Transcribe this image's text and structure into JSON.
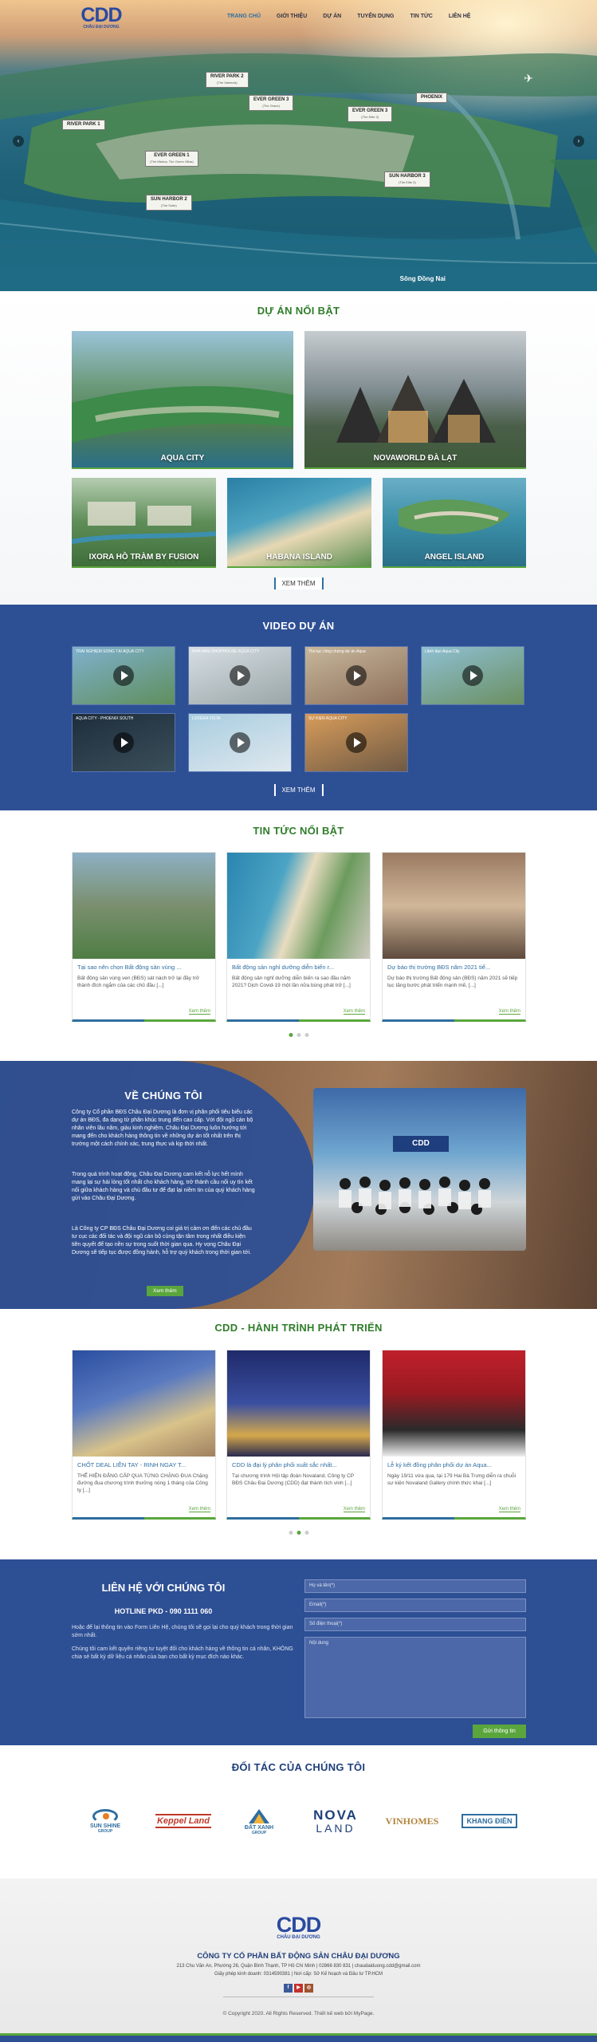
{
  "header": {
    "logo_text": "CDD",
    "logo_sub": "CHÂU ĐẠI DƯƠNG",
    "menu": [
      "TRANG CHỦ",
      "GIỚI THIỆU",
      "DỰ ÁN",
      "TUYỂN DỤNG",
      "TIN TỨC",
      "LIÊN HỆ"
    ],
    "active_color": "#2f6ea0"
  },
  "hero": {
    "labels": [
      {
        "name": "RIVER PARK 2",
        "sub": "(The Valencia)"
      },
      {
        "name": "RIVER PARK 1",
        "sub": ""
      },
      {
        "name": "EVER GREEN 3",
        "sub": "(The Grace)"
      },
      {
        "name": "EVER GREEN 3",
        "sub": "(The Elite 3)"
      },
      {
        "name": "PHOENIX",
        "sub": ""
      },
      {
        "name": "EVER GREEN 1",
        "sub": "(The Marina, The Green Villas)"
      },
      {
        "name": "SUN HARBOR 2",
        "sub": "(The Suite)"
      },
      {
        "name": "SUN HARBOR 3",
        "sub": "(The Elite 3)"
      }
    ],
    "river_label": "Sông Đồng Nai",
    "prev_icon": "chevron-left-icon",
    "next_icon": "chevron-right-icon"
  },
  "projects": {
    "title": "DỰ ÁN NỔI BẬT",
    "items": [
      "AQUA CITY",
      "NOVAWORLD ĐÀ LẠT",
      "IXORA HỒ TRÀM BY FUSION",
      "HABANA ISLAND",
      "ANGEL ISLAND"
    ],
    "more": "XEM THÊM"
  },
  "videos": {
    "title": "VIDEO DỰ ÁN",
    "items": [
      "TRẢI NGHIỆM SỐNG TẠI AQUA CITY",
      "NHÀ MẪU SHOPHOUSE AQUA CITY",
      "Thủ tục công chứng dự án Aqua",
      "Lãnh đạo Aqua City",
      "AQUA CITY - PHOENIX SOUTH",
      "LOVERA VISTA",
      "SỰ KIỆN AQUA CITY"
    ],
    "more": "XEM THÊM"
  },
  "news": {
    "title": "TIN TỨC NỔI BẬT",
    "items": [
      {
        "title": "Tại sao nên chọn Bất động sản vùng ...",
        "desc": "Bất động sản vùng ven (BĐS) sát nách trở lại đầy trở thành đích ngắm của các chủ đầu [...]",
        "more": "Xem thêm"
      },
      {
        "title": "Bất động sản nghỉ dưỡng diễn biến r...",
        "desc": "Bất động sản nghỉ dưỡng diễn biến ra sao đầu năm 2021? Dịch Covid-19 một lần nữa bùng phát trở [...]",
        "more": "Xem thêm"
      },
      {
        "title": "Dự báo thị trường BĐS năm 2021 tiế...",
        "desc": "Dự báo thị trường Bất động sản (BĐS) năm 2021 sẽ tiếp tục tăng bước phát triển mạnh mẽ, [...]",
        "more": "Xem thêm"
      }
    ]
  },
  "about": {
    "title": "VỀ CHÚNG TÔI",
    "p1": "Công ty Cổ phần BĐS Châu Đại Dương là đơn vị phân phối tiêu biểu các dự án BĐS, đa dạng từ phân khúc trung đến cao cấp. Với đội ngũ cán bộ nhân viên lâu năm, giàu kinh nghiệm. Châu Đại Dương luôn hướng tới mang đến cho khách hàng thông tin về những dự án tốt nhất trên thị trường một cách chính xác, trung thực và kịp thời nhất.",
    "p2": "Trong quá trình hoạt động, Châu Đại Dương cam kết nỗ lực hết mình mang lại sự hài lòng tốt nhất cho khách hàng, trở thành cầu nối uy tín kết nối giữa khách hàng và chủ đầu tư để đạt lại niềm tin của quý khách hàng gửi vào Châu Đại Dương.",
    "p3": "Là Công ty CP BĐS Châu Đại Dương coi giá trị cảm ơn đến các chủ đầu tư cục các đối tác và đội ngũ cán bộ cùng tận tâm trong nhất điều kiện tiên quyết để tạo nền sự trong suốt thời gian qua. Hy vọng Châu Đại Dương sẽ tiếp tục được đồng hành, hỗ trợ quý khách trong thời gian tới.",
    "button": "Xem thêm",
    "photo_caption": "CDD"
  },
  "timeline": {
    "title": "CDD - HÀNH TRÌNH PHÁT TRIỂN",
    "items": [
      {
        "title": "CHỐT DEAL LIỀN TAY - RINH NGAY T...",
        "desc": "THỂ HIỆN ĐẲNG CẤP QUA TỪNG CHẶNG ĐUA Chặng đường đua chương trình thưởng nóng 1 tháng của Công ty [...]",
        "more": "Xem thêm"
      },
      {
        "title": "CDD là đại lý phân phối xuất sắc nhất...",
        "desc": "Tại chương trình Hội tập đoàn Novaland, Công ty CP BĐS Châu Đại Dương (CDD) đạt thành tích vinh [...]",
        "more": "Xem thêm"
      },
      {
        "title": "Lễ ký kết đồng phân phối dự án Aqua...",
        "desc": "Ngày 19/11 vừa qua, tại 179 Hai Bà Trưng diễn ra chuỗi sự kiện Novaland Gallery chính thức khai [...]",
        "more": "Xem thêm"
      }
    ]
  },
  "contact": {
    "title": "LIÊN HỆ VỚI CHÚNG TÔI",
    "hotline": "HOTLINE PKD - 090 1111 060",
    "p1": "Hoặc để lại thông tin vào Form Liên Hệ, chúng tôi sẽ gọi lại cho quý khách trong thời gian sớm nhất.",
    "p2": "Chúng tôi cam kết quyền riêng tư tuyệt đối cho khách hàng về thông tin cá nhân, KHÔNG chia sẻ bất kỳ dữ liệu cá nhân của bạn cho bất kỳ mục đích nào khác.",
    "name_ph": "Họ và tên(*)",
    "email_ph": "Email(*)",
    "phone_ph": "Số điện thoại(*)",
    "msg_ph": "Nội dung",
    "submit": "Gửi thông tin"
  },
  "partners": {
    "title": "ĐỐI TÁC CỦA CHÚNG TÔI",
    "items": [
      {
        "name": "SUN SHINE",
        "sub": "GROUP",
        "color": "#2f6ea0"
      },
      {
        "name": "Keppel Land",
        "sub": "",
        "color": "#c0392b"
      },
      {
        "name": "ĐẤT XANH",
        "sub": "GROUP",
        "color": "#2f6ea0"
      },
      {
        "name": "NOVA",
        "sub": "LAND",
        "color": "#1d3f7a"
      },
      {
        "name": "VINHOMES",
        "sub": "",
        "color": "#b1843d"
      },
      {
        "name": "KHANG ĐIỀN",
        "sub": "",
        "color": "#2f6ea0"
      }
    ]
  },
  "footer": {
    "logo_text": "CDD",
    "logo_sub": "CHÂU ĐẠI DƯƠNG",
    "company": "CÔNG TY CỔ PHẦN BẤT ĐỘNG SẢN CHÂU ĐẠI DƯƠNG",
    "address": "213 Chu Văn An, Phường 26, Quận Bình Thạnh, TP Hồ Chí Minh | 02866 830 831 | chaudaiduong.cdd@gmail.com",
    "license": "Giấy phép kinh doanh: 0314590381 | Nơi cấp: Sở Kế hoạch và Đầu tư TP.HCM",
    "copyright": "© Copyright 2020. All Rights Reserved. Thiết kế web bởi MyPage.",
    "social": [
      "f",
      "▶",
      "◎"
    ]
  }
}
